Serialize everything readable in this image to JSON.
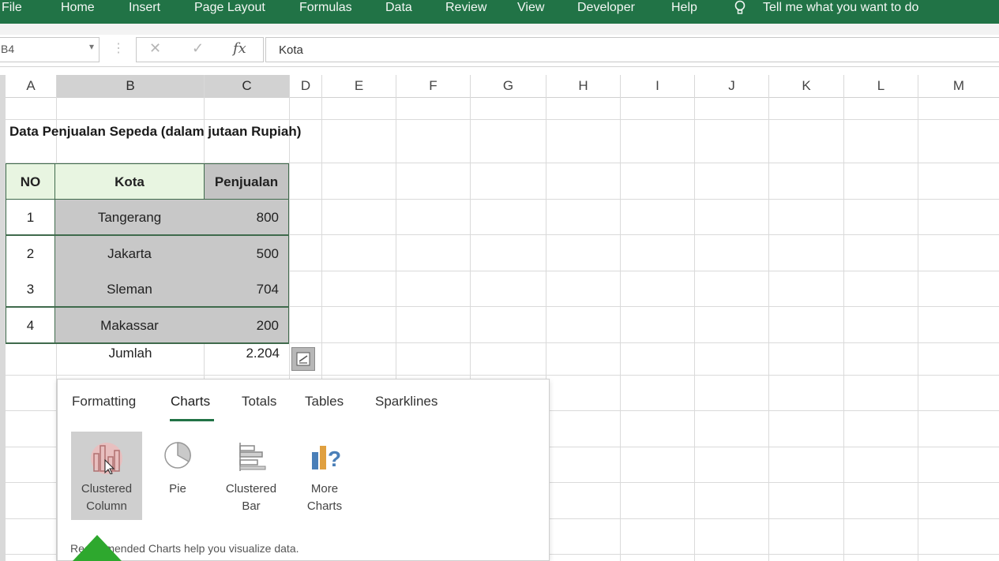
{
  "ribbon": {
    "tabs": [
      "File",
      "Home",
      "Insert",
      "Page Layout",
      "Formulas",
      "Data",
      "Review",
      "View",
      "Developer",
      "Help"
    ],
    "tell_me": "Tell me what you want to do",
    "color": "#217346"
  },
  "formula_bar": {
    "name_box": "B4",
    "cancel": "✕",
    "enter": "✓",
    "fx": "fx",
    "value": "Kota"
  },
  "columns": [
    "A",
    "B",
    "C",
    "D",
    "E",
    "F",
    "G",
    "H",
    "I",
    "J",
    "K",
    "L",
    "M"
  ],
  "sheet": {
    "title": "Data Penjualan Sepeda (dalam jutaan Rupiah)",
    "headers": {
      "no": "NO",
      "kota": "Kota",
      "penjualan": "Penjualan"
    },
    "rows": [
      {
        "no": "1",
        "kota": "Tangerang",
        "penjualan": "800"
      },
      {
        "no": "2",
        "kota": "Jakarta",
        "penjualan": "500"
      },
      {
        "no": "3",
        "kota": "Sleman",
        "penjualan": "704"
      },
      {
        "no": "4",
        "kota": "Makassar",
        "penjualan": "200"
      }
    ],
    "total_label": "Jumlah",
    "total_value": "2.204"
  },
  "quick_analysis": {
    "tabs": [
      "Formatting",
      "Charts",
      "Totals",
      "Tables",
      "Sparklines"
    ],
    "active_tab": "Charts",
    "items": [
      {
        "line1": "Clustered",
        "line2": "Column",
        "icon": "clustered-column-icon"
      },
      {
        "line1": "Pie",
        "line2": "",
        "icon": "pie-icon"
      },
      {
        "line1": "Clustered",
        "line2": "Bar",
        "icon": "clustered-bar-icon"
      },
      {
        "line1": "More",
        "line2": "Charts",
        "icon": "more-charts-icon"
      }
    ],
    "footer": "Recommended Charts help you visualize data."
  }
}
